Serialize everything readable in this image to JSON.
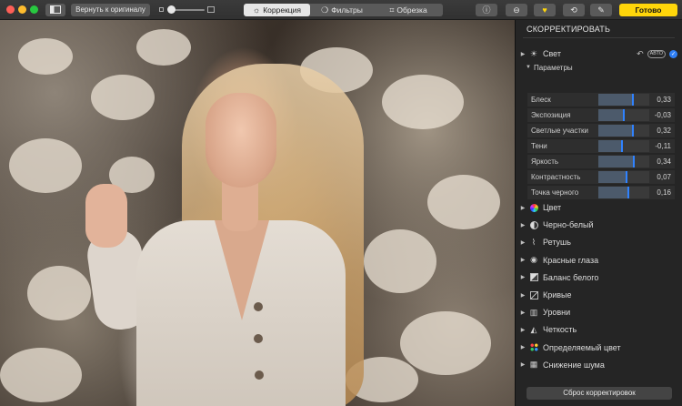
{
  "toolbar": {
    "revert_label": "Вернуть к оригиналу",
    "tabs": [
      {
        "label": "Коррекция",
        "icon": "☼",
        "active": true
      },
      {
        "label": "Фильтры",
        "icon": "❍",
        "active": false
      },
      {
        "label": "Обрезка",
        "icon": "⌗",
        "active": false
      }
    ],
    "icons": {
      "info": "ⓘ",
      "enhance": "⊖",
      "favorite": "♥",
      "rotate": "⟲",
      "magic": "✎"
    },
    "done_label": "Готово",
    "accent": "#ffd60a"
  },
  "panel": {
    "title": "СКОРРЕКТИРОВАТЬ",
    "light": {
      "label": "Свет",
      "icon": "☀",
      "undo_icon": "↶",
      "auto_label": "АВТО",
      "check_icon": "✓",
      "params_label": "Параметры",
      "sliders": [
        {
          "label": "Блеск",
          "value": "0,33",
          "level": 0.665
        },
        {
          "label": "Экспозиция",
          "value": "-0,03",
          "level": 0.485
        },
        {
          "label": "Светлые участки",
          "value": "0,32",
          "level": 0.66
        },
        {
          "label": "Тени",
          "value": "-0,11",
          "level": 0.445
        },
        {
          "label": "Яркость",
          "value": "0,34",
          "level": 0.67
        },
        {
          "label": "Контрастность",
          "value": "0,07",
          "level": 0.535
        },
        {
          "label": "Точка черного",
          "value": "0,16",
          "level": 0.58
        }
      ]
    },
    "sections": [
      {
        "label": "Цвет",
        "icon": "color-wheel"
      },
      {
        "label": "Черно-белый",
        "icon": "bw"
      },
      {
        "label": "Ретушь",
        "icon": "bandage"
      },
      {
        "label": "Красные глаза",
        "icon": "eye"
      },
      {
        "label": "Баланс белого",
        "icon": "wb"
      },
      {
        "label": "Кривые",
        "icon": "curves"
      },
      {
        "label": "Уровни",
        "icon": "levels"
      },
      {
        "label": "Четкость",
        "icon": "definition"
      },
      {
        "label": "Определяемый цвет",
        "icon": "selective-color"
      },
      {
        "label": "Снижение шума",
        "icon": "noise"
      }
    ],
    "reset_label": "Сброс корректировок"
  }
}
